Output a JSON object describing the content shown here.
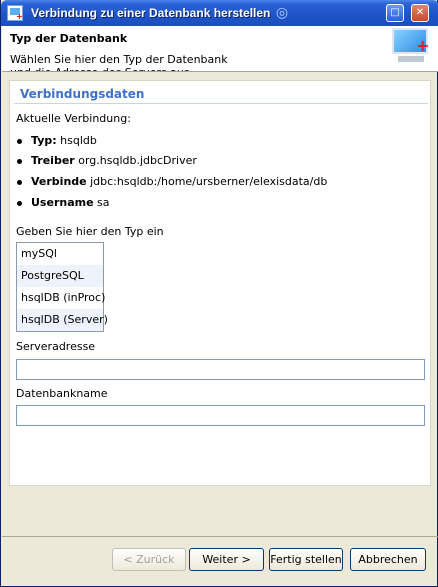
{
  "window": {
    "title": "Verbindung zu einer Datenbank herstellen",
    "minimize_icon": "maximize-icon",
    "close_icon": "close-icon"
  },
  "header": {
    "title": "Typ der Datenbank",
    "description": "Wählen Sie hier den Typ der Datenbank und die Adresse des Servers aus"
  },
  "section": {
    "title": "Verbindungsdaten",
    "current_label": "Aktuelle Verbindung:",
    "items": [
      {
        "key": "Typ:",
        "value": "hsqldb"
      },
      {
        "key": "Treiber",
        "value": "org.hsqldb.jdbcDriver"
      },
      {
        "key": "Verbinde",
        "value": "jdbc:hsqldb:/home/ursberner/elexisdata/db"
      },
      {
        "key": "Username",
        "value": "sa"
      }
    ]
  },
  "type_select": {
    "label": "Geben Sie hier den Typ ein",
    "options": [
      "mySQl",
      "PostgreSQL",
      "hsqlDB (inProc)",
      "hsqlDB (Server)"
    ]
  },
  "server_address": {
    "label": "Serveradresse",
    "value": ""
  },
  "database_name": {
    "label": "Datenbankname",
    "value": ""
  },
  "buttons": {
    "back": "< Zurück",
    "next": "Weiter >",
    "finish": "Fertig stellen",
    "cancel": "Abbrechen"
  }
}
